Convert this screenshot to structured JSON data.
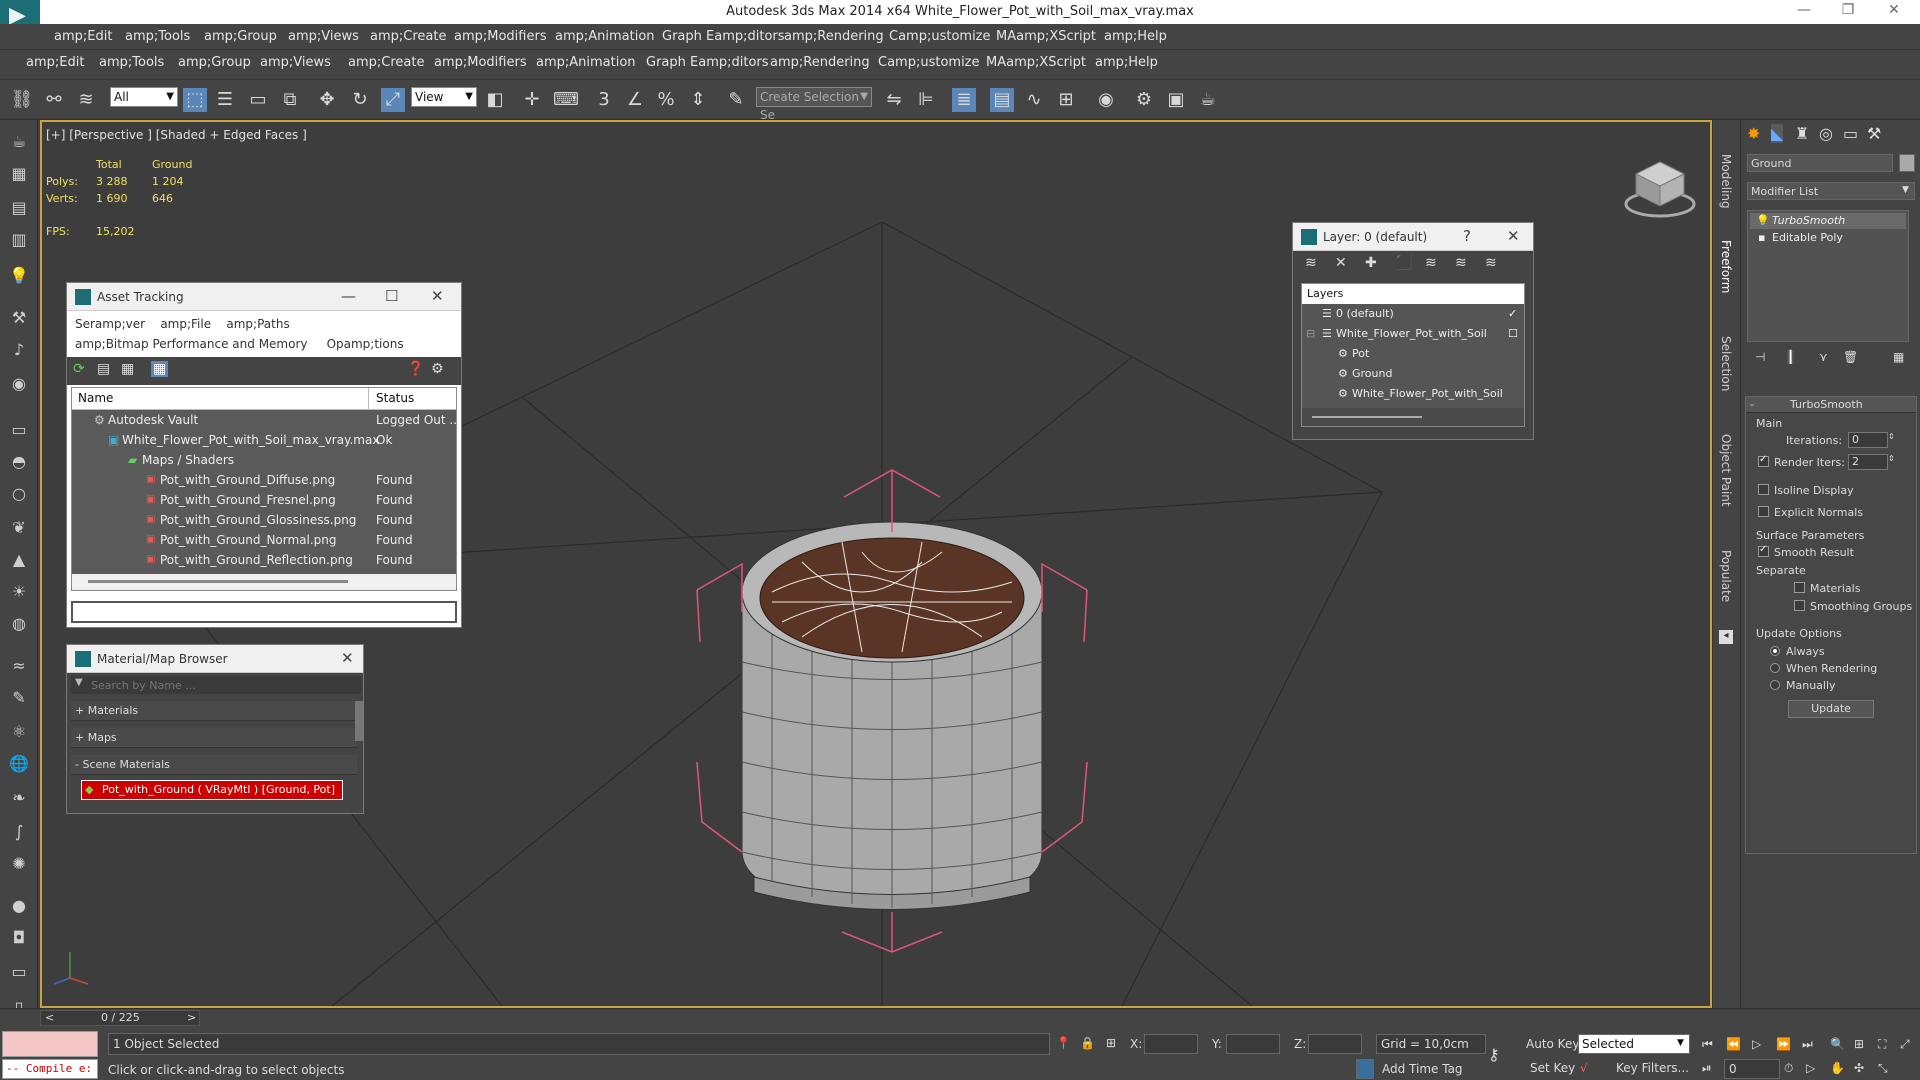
{
  "window": {
    "title": "Autodesk 3ds Max  2014 x64     White_Flower_Pot_with_Soil_max_vray.max"
  },
  "menu1": [
    "amp;Edit",
    "amp;Tools",
    "amp;Group",
    "amp;Views",
    "amp;Create",
    "amp;Modifiers",
    "amp;Animation",
    "Graph Eamp;ditors",
    "amp;Rendering",
    "Camp;ustomize",
    "MAamp;XScript",
    "amp;Help"
  ],
  "menu2": [
    "amp;Edit",
    "amp;Tools",
    "amp;Group",
    "amp;Views",
    "amp;Create",
    "amp;Modifiers",
    "amp;Animation",
    "Graph Eamp;ditors",
    "amp;Rendering",
    "Camp;ustomize",
    "MAamp;XScript",
    "amp;Help"
  ],
  "toolbar": {
    "filter_value": "All",
    "refcoord_value": "View",
    "selset_placeholder": "Create Selection Se",
    "snap_label": "3"
  },
  "viewport": {
    "label": "[+] [Perspective ] [Shaded + Edged Faces ]",
    "stats": {
      "hdr_total": "Total",
      "hdr_ground": "Ground",
      "polys_label": "Polys:",
      "polys_total": "3 288",
      "polys_ground": "1 204",
      "verts_label": "Verts:",
      "verts_total": "1 690",
      "verts_ground": "646",
      "fps_label": "FPS:",
      "fps_value": "15,202"
    }
  },
  "asset_tracking": {
    "title": "Asset Tracking",
    "menu": [
      "Seramp;ver",
      "amp;File",
      "amp;Paths"
    ],
    "menu2": [
      "amp;Bitmap Performance and Memory",
      "Opamp;tions"
    ],
    "col_name": "Name",
    "col_status": "Status",
    "rows": [
      {
        "name": "Autodesk Vault",
        "status": "Logged Out ..."
      },
      {
        "name": "White_Flower_Pot_with_Soil_max_vray.max",
        "status": "Ok"
      },
      {
        "name": "Maps / Shaders",
        "status": ""
      },
      {
        "name": "Pot_with_Ground_Diffuse.png",
        "status": "Found"
      },
      {
        "name": "Pot_with_Ground_Fresnel.png",
        "status": "Found"
      },
      {
        "name": "Pot_with_Ground_Glossiness.png",
        "status": "Found"
      },
      {
        "name": "Pot_with_Ground_Normal.png",
        "status": "Found"
      },
      {
        "name": "Pot_with_Ground_Reflection.png",
        "status": "Found"
      }
    ]
  },
  "material_browser": {
    "title": "Material/Map Browser",
    "search_placeholder": "Search by Name ...",
    "group_materials": "+ Materials",
    "group_maps": "+ Maps",
    "group_scene": "- Scene Materials",
    "selected_material": "Pot_with_Ground  ( VRayMtl )  [Ground, Pot]"
  },
  "layer_window": {
    "title": "Layer: 0 (default)",
    "help": "?",
    "header": "Layers",
    "items": [
      "0 (default)",
      "White_Flower_Pot_with_Soil",
      "Pot",
      "Ground",
      "White_Flower_Pot_with_Soil"
    ]
  },
  "command_panel": {
    "object_name": "Ground",
    "modifier_list": "Modifier List",
    "stack": [
      "TurboSmooth",
      "Editable Poly"
    ],
    "rollout_title": "TurboSmooth",
    "main_label": "Main",
    "iterations_label": "Iterations:",
    "iterations_value": "0",
    "render_iters_label": "Render Iters:",
    "render_iters_value": "2",
    "render_iters_checked": true,
    "isoline_label": "Isoline Display",
    "explicit_label": "Explicit Normals",
    "surface_label": "Surface Parameters",
    "smooth_result_label": "Smooth Result",
    "separate_label": "Separate",
    "materials_label": "Materials",
    "smoothing_groups_label": "Smoothing Groups",
    "update_options_label": "Update Options",
    "always_label": "Always",
    "when_rendering_label": "When Rendering",
    "manually_label": "Manually",
    "update_button": "Update"
  },
  "side_tabs": [
    "Modeling",
    "Freeform",
    "Selection",
    "Object Paint",
    "Populate"
  ],
  "timeline": {
    "frame_label": "0 / 225"
  },
  "status": {
    "script_text": "-- Compile e:",
    "selected_text": "1 Object Selected",
    "prompt_text": "Click or click-and-drag to select objects",
    "x_label": "X:",
    "y_label": "Y:",
    "z_label": "Z:",
    "grid_text": "Grid = 10,0cm",
    "add_time_tag": "Add Time Tag",
    "auto_key": "Auto Key",
    "set_key": "Set Key",
    "selected_dropdown": "Selected",
    "key_filters": "Key Filters...",
    "frame_value": "0"
  },
  "colors": {
    "viewport_border": "#c9a53d",
    "stat_text": "#f0e060",
    "selection_bracket": "#e0557a",
    "material_selected_bg": "#cc0000",
    "soil": "#5a3424",
    "pot": "#a9a9a9"
  }
}
